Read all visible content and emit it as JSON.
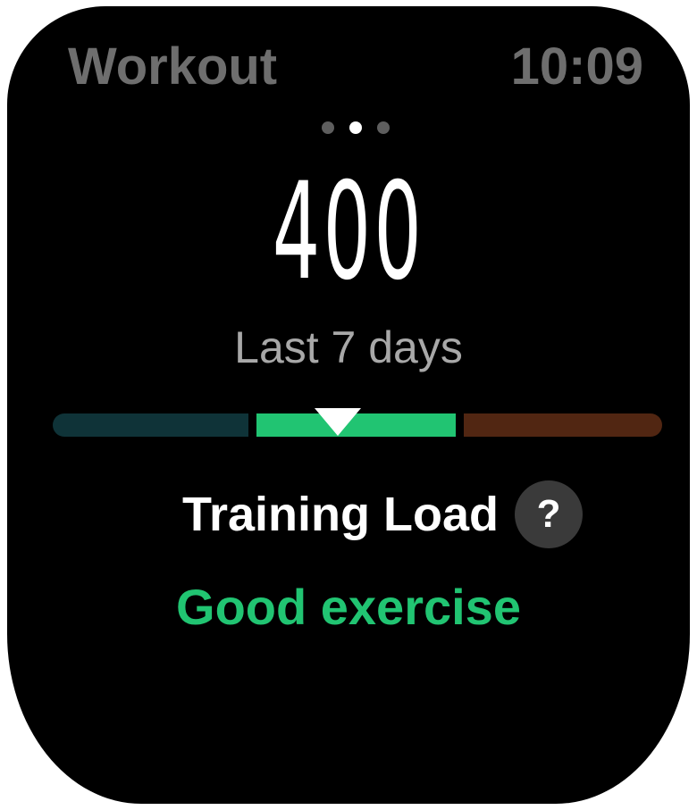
{
  "header": {
    "title": "Workout",
    "time": "10:09"
  },
  "pager": {
    "count": 3,
    "active_index": 1
  },
  "training_load": {
    "value": "400",
    "period": "Last 7 days",
    "label": "Training Load",
    "help_symbol": "?",
    "status": "Good exercise",
    "scale": {
      "zones": [
        "low",
        "good",
        "high"
      ],
      "marker_position_fraction": 0.47
    }
  },
  "colors": {
    "zone_low": "#0f3338",
    "zone_good": "#21c472",
    "zone_high": "#512612",
    "status": "#21c472"
  },
  "icons": {
    "help": "question-mark-icon",
    "marker": "triangle-down-icon"
  }
}
